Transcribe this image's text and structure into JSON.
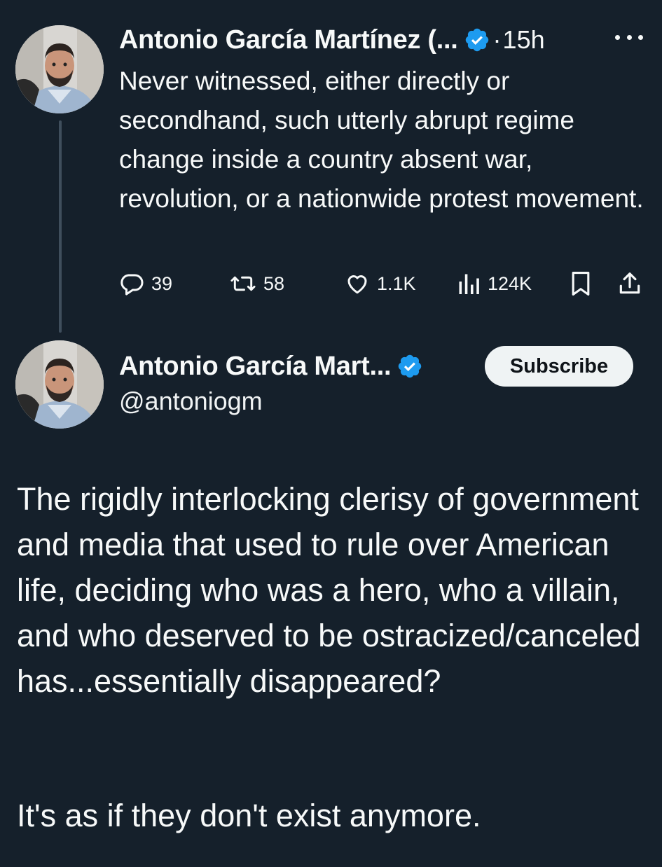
{
  "tweet1": {
    "author_name": "Antonio García Martínez (...",
    "separator": "·",
    "time": "15h",
    "text": "Never witnessed, either directly or secondhand, such utterly abrupt regime change inside a country absent war, revolution, or a nationwide protest movement.",
    "actions": {
      "replies": "39",
      "reposts": "58",
      "likes": "1.1K",
      "views": "124K"
    }
  },
  "tweet2": {
    "author_name": "Antonio García Mart...",
    "handle": "@antoniogm",
    "subscribe_label": "Subscribe",
    "paragraph1": "The rigidly interlocking clerisy of government and media that used to rule over American life, deciding who was a hero, who a villain, and who deserved to be ostracized/canceled has...essentially disappeared?",
    "paragraph2": "It's as if they don't exist anymore."
  },
  "icons": {
    "more": "more-horizontal-icon",
    "reply": "reply-bubble-icon",
    "repost": "repost-arrows-icon",
    "like": "heart-icon",
    "views": "bar-chart-icon",
    "bookmark": "bookmark-icon",
    "share": "share-upload-icon",
    "verified": "verified-badge-icon"
  },
  "colors": {
    "background": "#15202b",
    "text": "#f7f9f9",
    "verified_badge": "#1d9bf0",
    "thread_line": "#3f4e5c",
    "subscribe_bg": "#eff3f4"
  }
}
